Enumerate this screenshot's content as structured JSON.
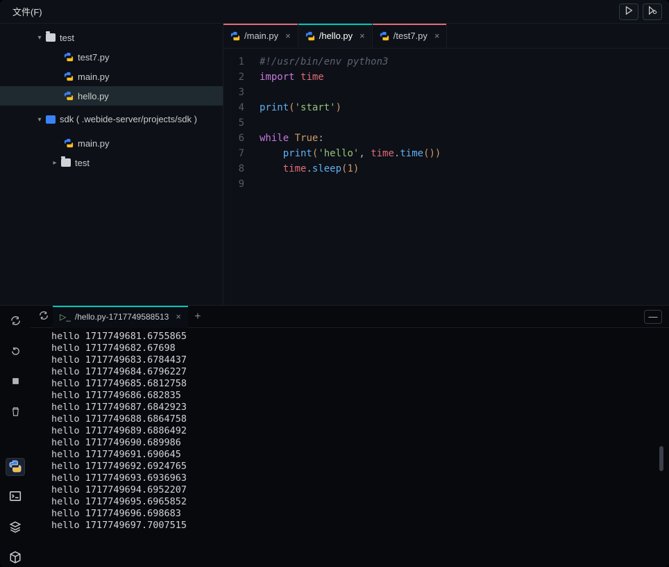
{
  "menubar": {
    "file": "文件(F)"
  },
  "tree": {
    "root1": {
      "name": "test",
      "expanded": true,
      "files": [
        {
          "name": "test7.py"
        },
        {
          "name": "main.py"
        },
        {
          "name": "hello.py",
          "active": true
        }
      ]
    },
    "root2": {
      "name": "sdk ( .webide-server/projects/sdk )",
      "expanded": true,
      "files": [
        {
          "name": "main.py"
        }
      ],
      "folders": [
        {
          "name": "test"
        }
      ]
    }
  },
  "tabs": [
    {
      "label": "/main.py",
      "active": false,
      "indicator": "red"
    },
    {
      "label": "/hello.py",
      "active": true,
      "indicator": "cyan"
    },
    {
      "label": "/test7.py",
      "active": false,
      "indicator": "red"
    }
  ],
  "editor": {
    "line1_cmt": "#!/usr/bin/env python3",
    "kw_import": "import",
    "mod_time": "time",
    "fn_print": "print",
    "str_start": "'start'",
    "kw_while": "while",
    "kw_true": "True",
    "str_hello": "'hello'",
    "fn_time": "time",
    "fn_sleep": "sleep",
    "num_one": "1",
    "line_numbers": [
      "1",
      "2",
      "3",
      "4",
      "5",
      "6",
      "7",
      "8",
      "9"
    ]
  },
  "terminal": {
    "tab_label": "/hello.py-1717749588513",
    "lines": [
      "hello 1717749681.6755865",
      "hello 1717749682.67698",
      "hello 1717749683.6784437",
      "hello 1717749684.6796227",
      "hello 1717749685.6812758",
      "hello 1717749686.682835",
      "hello 1717749687.6842923",
      "hello 1717749688.6864758",
      "hello 1717749689.6886492",
      "hello 1717749690.689986",
      "hello 1717749691.690645",
      "hello 1717749692.6924765",
      "hello 1717749693.6936963",
      "hello 1717749694.6952207",
      "hello 1717749695.6965852",
      "hello 1717749696.698683",
      "hello 1717749697.7007515"
    ]
  }
}
